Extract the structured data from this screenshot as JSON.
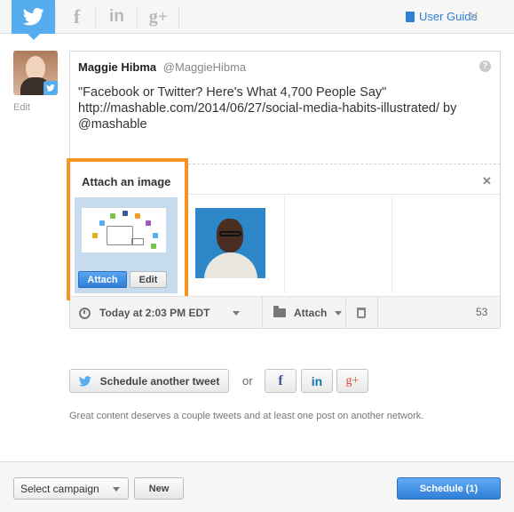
{
  "networks": [
    {
      "name": "twitter",
      "icon": "twitter-icon",
      "active": true
    },
    {
      "name": "facebook",
      "glyph": "f",
      "icon": "facebook-icon"
    },
    {
      "name": "linkedin",
      "glyph": "in",
      "icon": "linkedin-icon"
    },
    {
      "name": "google-plus",
      "glyph": "g+",
      "icon": "google-plus-icon"
    }
  ],
  "header": {
    "user_guide_label": "User Guide",
    "close_glyph": "✕"
  },
  "profile": {
    "edit_label": "Edit"
  },
  "tweet": {
    "author_name": "Maggie Hibma",
    "author_handle": "@MaggieHibma",
    "help_glyph": "?",
    "text": "\"Facebook or Twitter? Here's What 4,700 People Say\"\nhttp://mashable.com/2014/06/27/social-media-habits-illustrated/ by\n@mashable"
  },
  "attach_panel": {
    "title": "Attach an image",
    "close_glyph": "✕",
    "attach_button": "Attach",
    "edit_button": "Edit"
  },
  "composer_bar": {
    "schedule_time": "Today at 2:03 PM EDT",
    "attach_label": "Attach",
    "char_count": "53"
  },
  "share": {
    "schedule_another_label": "Schedule another tweet",
    "or_label": "or",
    "facebook_glyph": "f",
    "linkedin_glyph": "in",
    "google_glyph": "g+",
    "hint": "Great content deserves a couple tweets and at least one post on another network."
  },
  "footer": {
    "campaign_select": "Select campaign",
    "new_button": "New",
    "schedule_button": "Schedule (1)"
  },
  "colors": {
    "twitter_blue": "#55acee",
    "highlight_orange": "#f7941d",
    "primary_button": "#2f7fd8",
    "facebook_blue": "#3b5998",
    "linkedin_blue": "#0e76a8",
    "google_red": "#dd4b39"
  }
}
